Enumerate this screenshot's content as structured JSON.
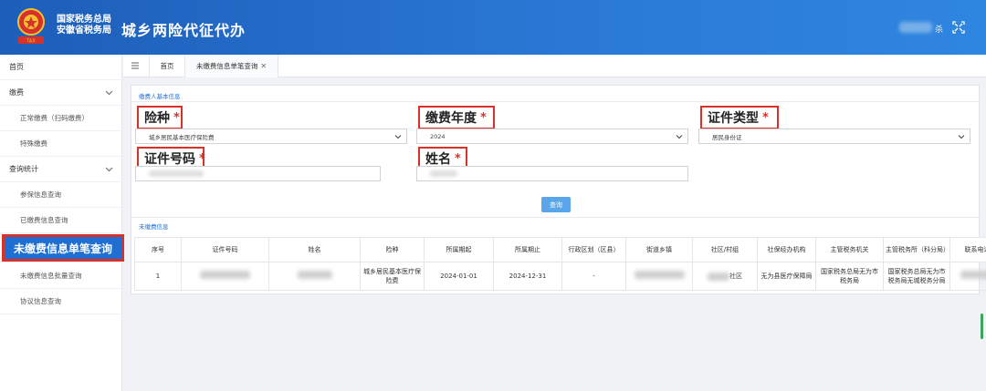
{
  "header": {
    "org_line1": "国家税务总局",
    "org_line2": "安徽省税务局",
    "app_title": "城乡两险代征代办",
    "user_suffix": "杀"
  },
  "sidebar": {
    "items": [
      {
        "label": "首页"
      },
      {
        "label": "缴费"
      },
      {
        "label": "正常缴费（扫码缴费）"
      },
      {
        "label": "特殊缴费"
      },
      {
        "label": "查询统计"
      },
      {
        "label": "参保信息查询"
      },
      {
        "label": "已缴费信息查询"
      },
      {
        "label": "未缴费信息单笔查询"
      },
      {
        "label": "未缴费信息批量查询"
      },
      {
        "label": "协议信息查询"
      }
    ]
  },
  "tabs": {
    "home": "首页",
    "current": "未缴费信息单笔查询",
    "close": "✕"
  },
  "form": {
    "section_title": "缴费人基本信息",
    "required_mark": "*",
    "insurance_label": "险种",
    "insurance_value": "城乡居民基本医疗保险费",
    "year_label": "缴费年度",
    "year_value": "2024",
    "idtype_label": "证件类型",
    "idtype_value": "居民身份证",
    "idno_label": "证件号码",
    "name_label": "姓名",
    "query_button": "查询"
  },
  "result": {
    "section_title": "未缴费信息",
    "headers": [
      "序号",
      "证件号码",
      "姓名",
      "险种",
      "所属期起",
      "所属期止",
      "行政区划（区县）",
      "街道乡镇",
      "社区/村组",
      "社保经办机构",
      "主管税务机关",
      "主管税务所（科分局）",
      "联系电话"
    ],
    "rows": [
      {
        "seq": "1",
        "insurance": "城乡居民基本医疗保险费",
        "start": "2024-01-01",
        "end": "2024-12-31",
        "district": "-",
        "community_suffix": "社区",
        "social_agency": "无为县医疗保障局",
        "tax_authority": "国家税务总局无为市税务局",
        "tax_branch": "国家税务总局无为市税务局无城税务分局"
      }
    ]
  },
  "colors": {
    "header_blue": "#1d5eb9",
    "active_blue": "#1e6fd1",
    "highlight_red": "#d8312a",
    "button_blue": "#5aa6e8"
  }
}
